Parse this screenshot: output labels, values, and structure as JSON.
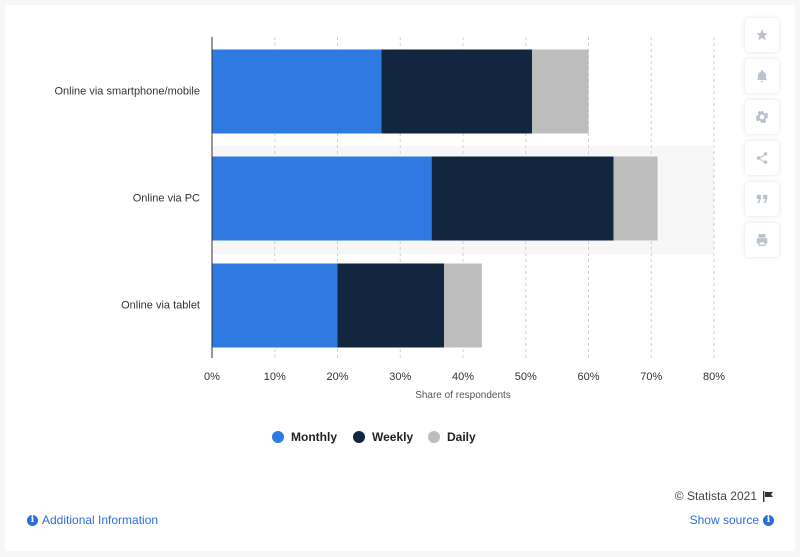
{
  "chart_data": {
    "type": "bar",
    "orientation": "horizontal",
    "stacked": true,
    "categories": [
      "Online via smartphone/mobile",
      "Online via PC",
      "Online via tablet"
    ],
    "series": [
      {
        "name": "Monthly",
        "values": [
          27,
          35,
          20
        ],
        "color": "#2f7ae0"
      },
      {
        "name": "Weekly",
        "values": [
          24,
          29,
          17
        ],
        "color": "#13263f"
      },
      {
        "name": "Daily",
        "values": [
          9,
          7,
          6
        ],
        "color": "#bdbdbd"
      }
    ],
    "xlabel": "Share of respondents",
    "xlim": [
      0,
      80
    ],
    "xticks": [
      "0%",
      "10%",
      "20%",
      "30%",
      "40%",
      "50%",
      "60%",
      "70%",
      "80%"
    ],
    "grid": true,
    "legend_position": "bottom"
  },
  "footer": {
    "additional_info": "Additional Information",
    "copyright": "© Statista 2021",
    "show_source": "Show source"
  },
  "toolbar": {
    "icons": [
      "star-icon",
      "bell-icon",
      "gear-icon",
      "share-icon",
      "quote-icon",
      "print-icon"
    ]
  }
}
